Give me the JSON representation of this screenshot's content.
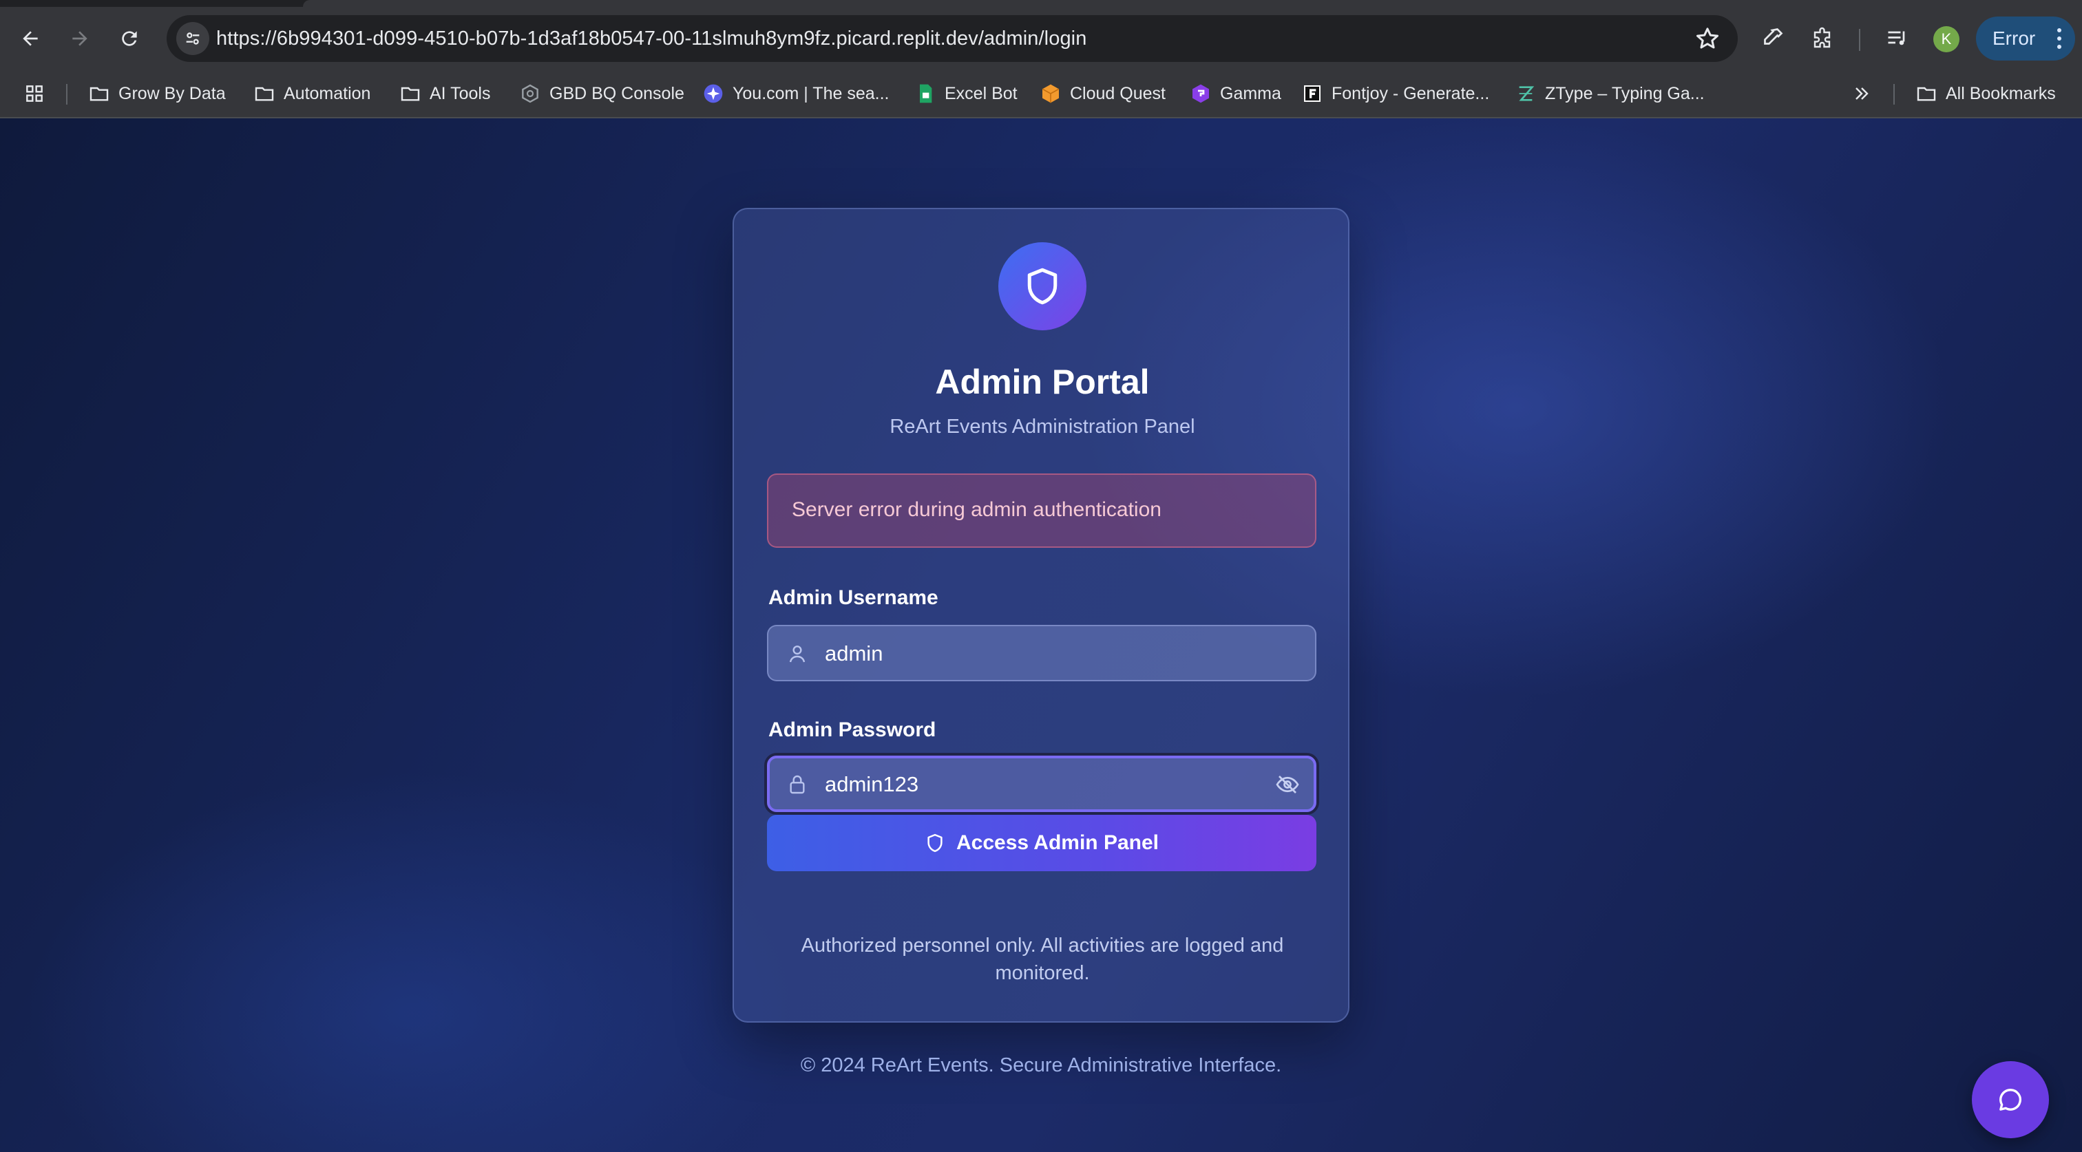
{
  "browser": {
    "url": "https://6b994301-d099-4510-b07b-1d3af18b0547-00-11slmuh8ym9fz.picard.replit.dev/admin/login",
    "profile_initial": "K",
    "error_label": "Error",
    "bookmarks": [
      {
        "label": "Grow By Data",
        "icon": "folder-icon"
      },
      {
        "label": "Automation",
        "icon": "folder-icon"
      },
      {
        "label": "AI Tools",
        "icon": "folder-icon"
      },
      {
        "label": "GBD BQ Console",
        "icon": "cloud-console-icon"
      },
      {
        "label": "You.com | The sea...",
        "icon": "youcom-icon"
      },
      {
        "label": "Excel Bot",
        "icon": "sheets-icon"
      },
      {
        "label": "Cloud Quest",
        "icon": "cube-icon"
      },
      {
        "label": "Gamma",
        "icon": "gamma-icon"
      },
      {
        "label": "Fontjoy - Generate...",
        "icon": "fontjoy-icon"
      },
      {
        "label": "ZType – Typing Ga...",
        "icon": "ztype-icon"
      }
    ],
    "all_bookmarks_label": "All Bookmarks"
  },
  "login": {
    "title": "Admin Portal",
    "subtitle": "ReArt Events Administration Panel",
    "error_message": "Server error during admin authentication",
    "username_label": "Admin Username",
    "username_value": "admin",
    "password_label": "Admin Password",
    "password_value": "admin123",
    "submit_label": "Access Admin Panel",
    "notice": "Authorized personnel only. All activities are logged and monitored."
  },
  "footer": "© 2024 ReArt Events. Secure Administrative Interface.",
  "colors": {
    "accent_start": "#3d6ef2",
    "accent_end": "#7b43e6",
    "error_bg": "#b4466e",
    "chat_button": "#6a3be2"
  }
}
